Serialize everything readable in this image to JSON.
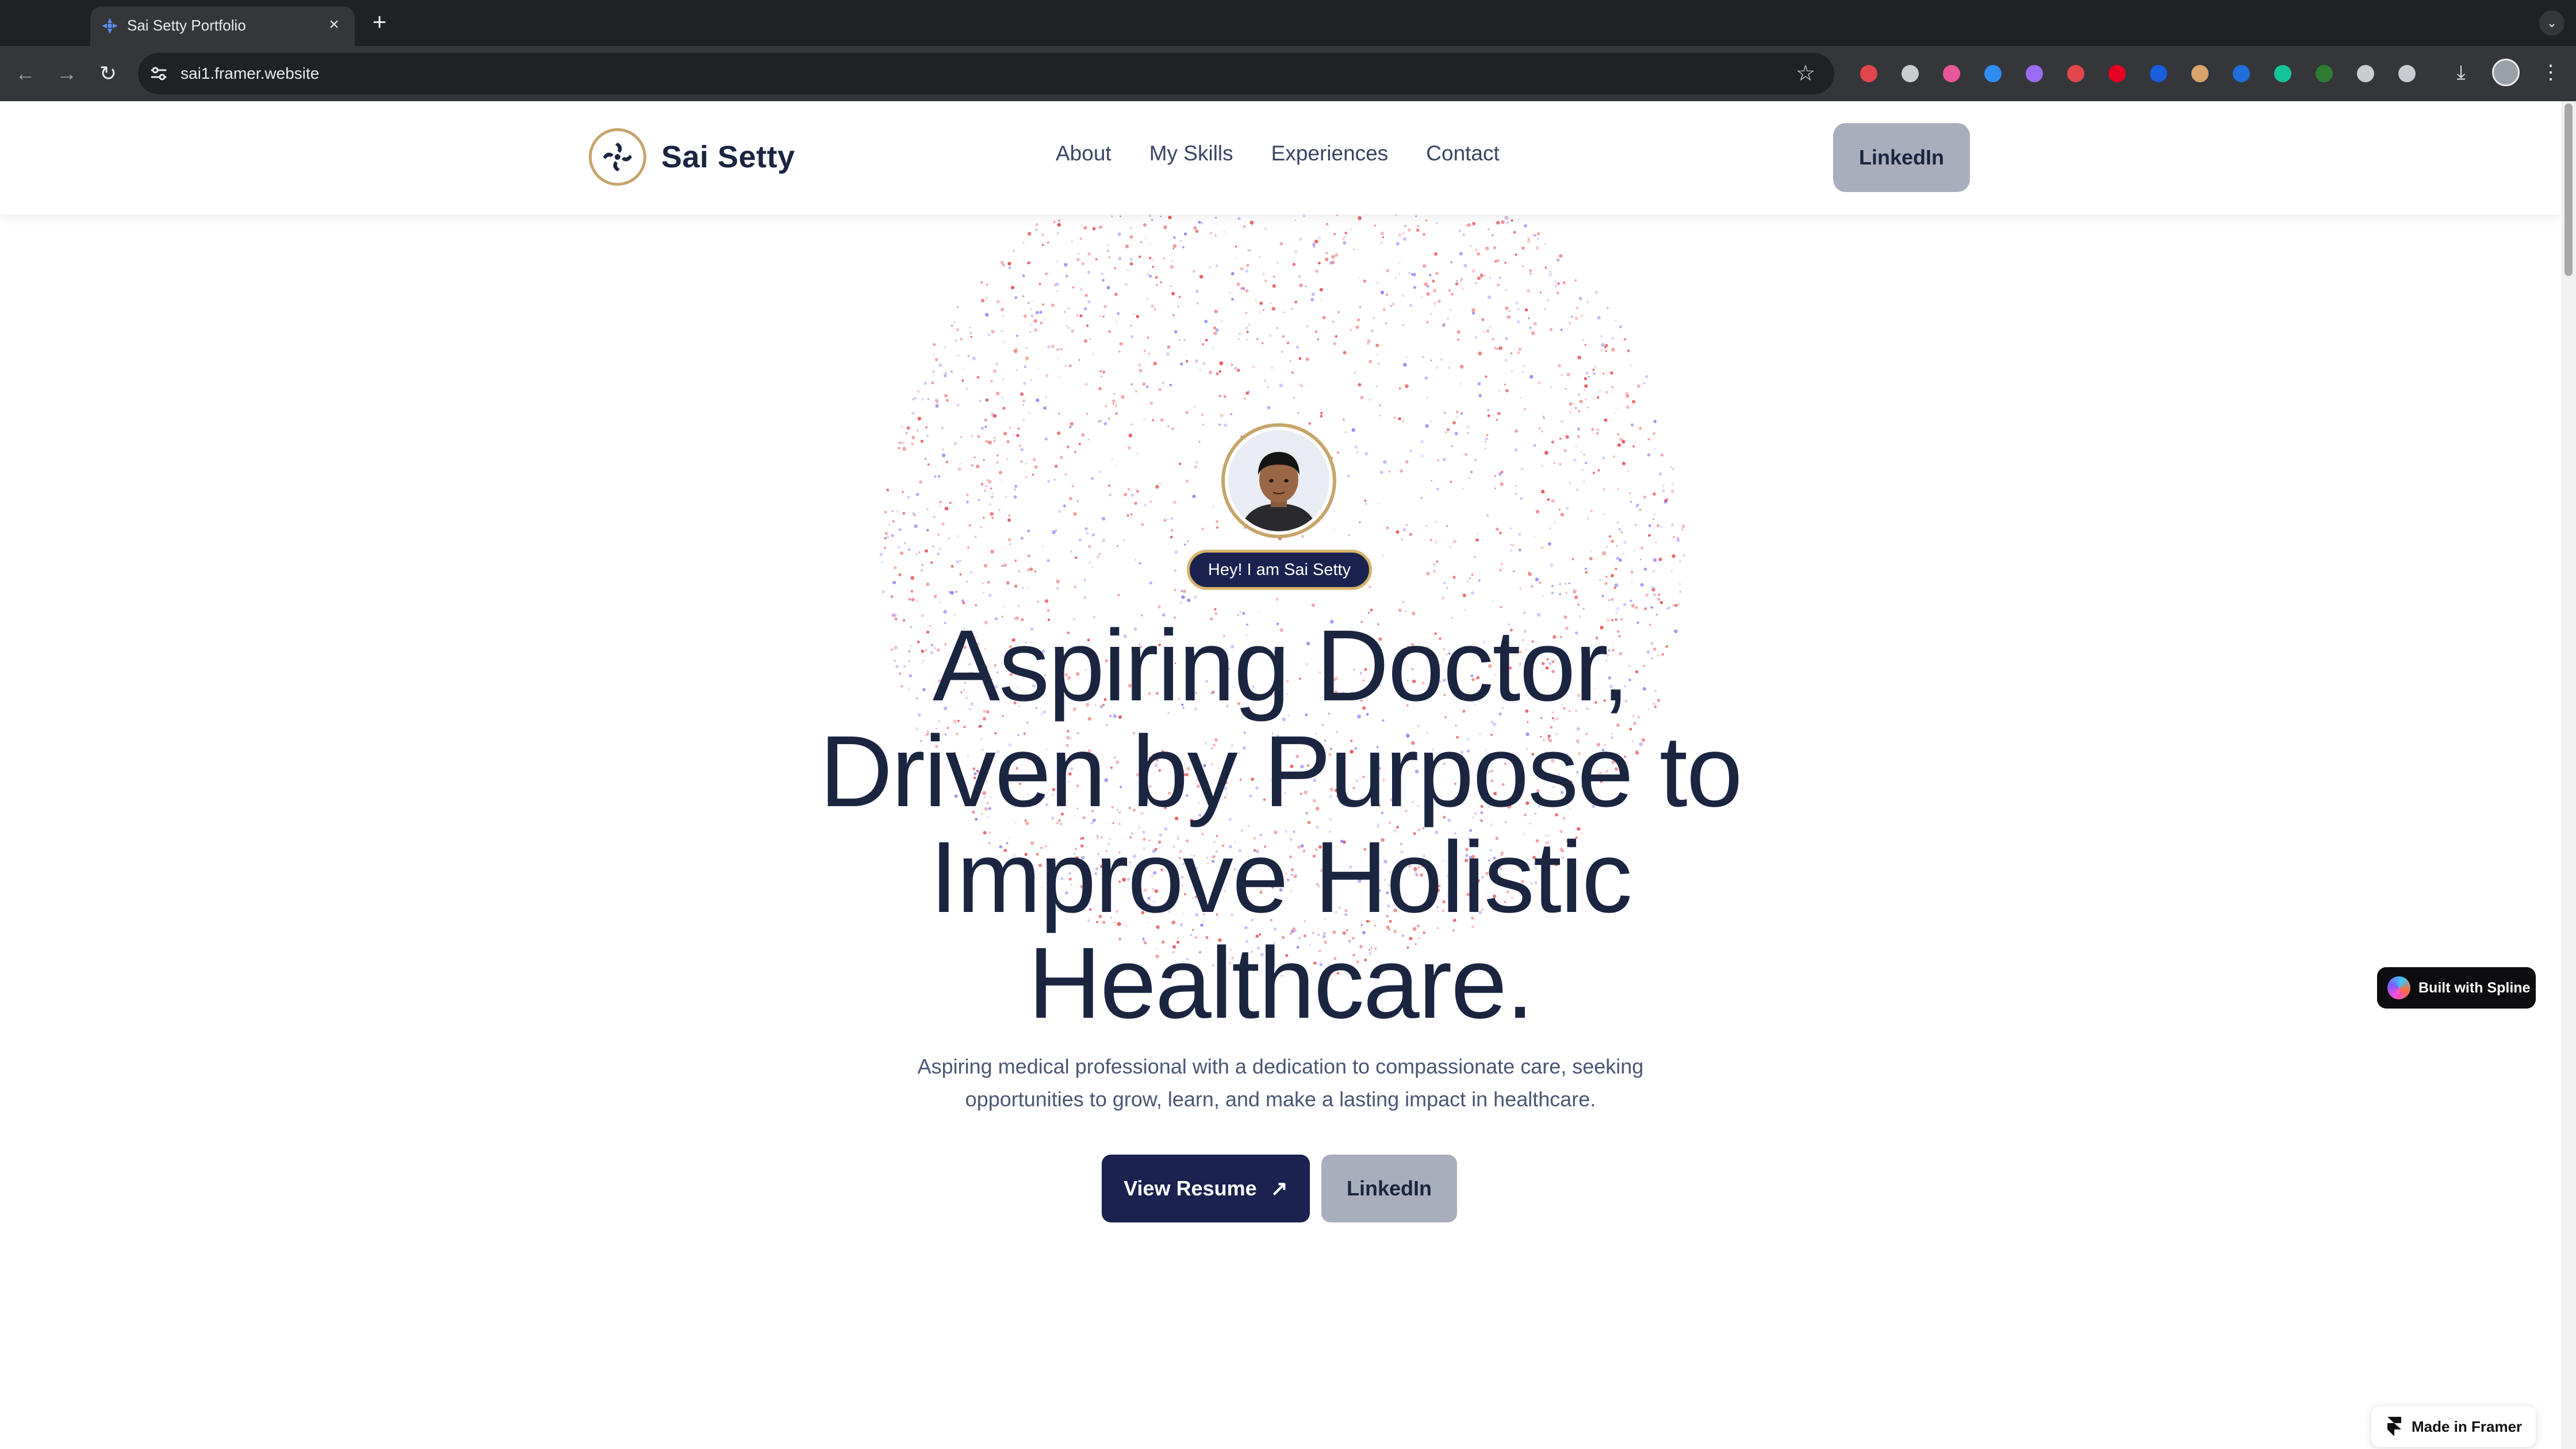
{
  "browser": {
    "tab_title": "Sai Setty Portfolio",
    "url": "sai1.framer.website",
    "close_glyph": "×",
    "new_tab_glyph": "+",
    "extensions": [
      {
        "name": "ext-shield-icon",
        "color": "#e0464c"
      },
      {
        "name": "ext-camera-icon",
        "color": "#c9ccd1"
      },
      {
        "name": "ext-video-icon",
        "color": "#e8569a"
      },
      {
        "name": "ext-check-icon",
        "color": "#2f8df2"
      },
      {
        "name": "ext-feather-icon",
        "color": "#9b6cf5"
      },
      {
        "name": "ext-scissors-icon",
        "color": "#e0464c"
      },
      {
        "name": "ext-pinterest-icon",
        "color": "#e60023"
      },
      {
        "name": "ext-bitwarden-icon",
        "color": "#175ddc"
      },
      {
        "name": "ext-face-icon",
        "color": "#d7a46a"
      },
      {
        "name": "ext-p-icon",
        "color": "#1e6fd9"
      },
      {
        "name": "ext-grammarly-icon",
        "color": "#15c39a"
      },
      {
        "name": "ext-tag-icon",
        "color": "#2e7d32"
      },
      {
        "name": "ext-guard-icon",
        "color": "#c9ccd1"
      },
      {
        "name": "ext-puzzle-icon",
        "color": "#c9ccd1"
      }
    ]
  },
  "site": {
    "brand_name": "Sai Setty",
    "nav": [
      "About",
      "My Skills",
      "Experiences",
      "Contact"
    ],
    "header_cta": "LinkedIn",
    "greeting": "Hey! I am Sai Setty",
    "hero_title_lines": [
      "Aspiring Doctor,",
      "Driven by Purpose to",
      "Improve Holistic",
      "Healthcare."
    ],
    "hero_sub_lines": [
      "Aspiring medical professional with a dedication to compassionate care, seeking",
      "opportunities to grow, learn, and make a lasting impact in healthcare."
    ],
    "primary_button": "View Resume",
    "primary_button_icon": "↗",
    "secondary_button": "LinkedIn"
  },
  "badges": {
    "spline": "Built with Spline",
    "framer": "Made in Framer"
  },
  "colors": {
    "brand_navy": "#1b2250",
    "heading": "#1b2540",
    "accent_gold": "#c6a56a",
    "particle_red": "#e5484d",
    "particle_violet": "#8b7cf6",
    "secondary_button": "#a9aebc"
  }
}
